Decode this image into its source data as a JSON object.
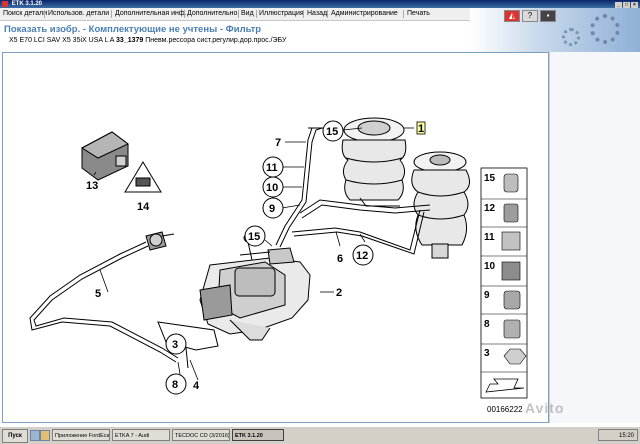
{
  "window": {
    "title": "ETK 3.1.20"
  },
  "menu": [
    {
      "name": "menu-show-parts",
      "label": "Поиск детали"
    },
    {
      "name": "menu-use-parts",
      "label": "Использов. детали"
    },
    {
      "name": "menu-extra-info",
      "label": "Дополнительная инф."
    },
    {
      "name": "menu-service-info",
      "label": "Дополнительно"
    },
    {
      "name": "menu-view",
      "label": "Вид"
    },
    {
      "name": "menu-illustration",
      "label": "Иллюстрация"
    },
    {
      "name": "menu-back",
      "label": "Назад"
    },
    {
      "name": "menu-admin",
      "label": "Администрирование"
    },
    {
      "name": "menu-print",
      "label": "Печать"
    }
  ],
  "header": {
    "title": "Показать изобр. - Комплектующие не учтены - Фильтр",
    "vehicle": "X5 E70 LCI SAV X5 35iX USA  L A",
    "diagram_code": "33_1379",
    "diagram_desc": "Пневм.рессора сист.регулир.дор.прос./ЭБУ"
  },
  "callouts": [
    "1",
    "2",
    "3",
    "4",
    "5",
    "6",
    "7",
    "8",
    "9",
    "10",
    "11",
    "12",
    "13",
    "14",
    "15"
  ],
  "side_items": [
    "15",
    "12",
    "11",
    "10",
    "9",
    "8",
    "3"
  ],
  "figure_id": "00166222",
  "taskbar": {
    "start": "Пуск",
    "buttons": [
      "Приложение FordEcat - ...",
      "ETKA 7 - Audi",
      "TECDOC CD (3/2016)",
      "ETK 3.1.20"
    ],
    "clock": "15:20"
  },
  "watermark": "Avito"
}
